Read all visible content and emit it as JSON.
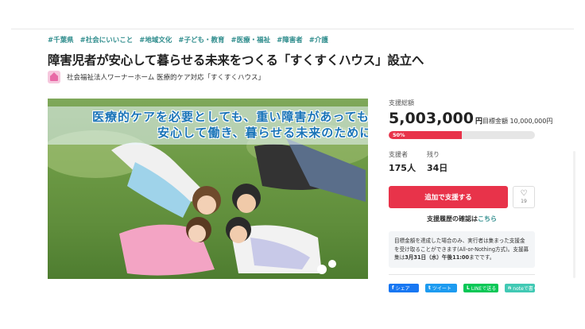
{
  "tags": [
    "#千葉県",
    "#社会にいいこと",
    "#地域文化",
    "#子ども・教育",
    "#医療・福祉",
    "#障害者",
    "#介護"
  ],
  "title": "障害児者が安心して暮らせる未来をつくる「すくすくハウス」設立へ",
  "organization": "社会福祉法人ワーナーホーム 医療的ケア対応「すくすくハウス」",
  "hero": {
    "line1": "医療的ケアを必要としても、重い障害があっても",
    "line2": "安心して働き、暮らせる未来のために"
  },
  "funding": {
    "label": "支援総額",
    "amount": "5,003,000",
    "currency": "円",
    "goal_text": "目標金額 10,000,000円",
    "progress_percent": 50,
    "progress_label": "50%"
  },
  "stats": {
    "supporters_label": "支援者",
    "supporters_value": "175人",
    "remaining_label": "残り",
    "remaining_value": "34日"
  },
  "actions": {
    "support_label": "追加で支援する",
    "like_count": "19"
  },
  "history": {
    "text": "支援履歴の確認は",
    "link": "こちら"
  },
  "notice": {
    "part1": "目標金額を達成した場合のみ、実行者は集まった支援金を受け取ることができます(All-or-Nothing方式)。支援募集は",
    "deadline": "3月31日（水）午後11:00",
    "part2": "までです。"
  },
  "share": {
    "facebook": "シェア",
    "twitter": "ツイート",
    "line": "LINEで送る",
    "note": "noteで書く"
  },
  "colors": {
    "accent_red": "#e8334a",
    "tag_teal": "#2e8c8c",
    "facebook": "#1877f2",
    "twitter": "#1d9bf0",
    "line": "#06c755",
    "note": "#41c9b4"
  }
}
